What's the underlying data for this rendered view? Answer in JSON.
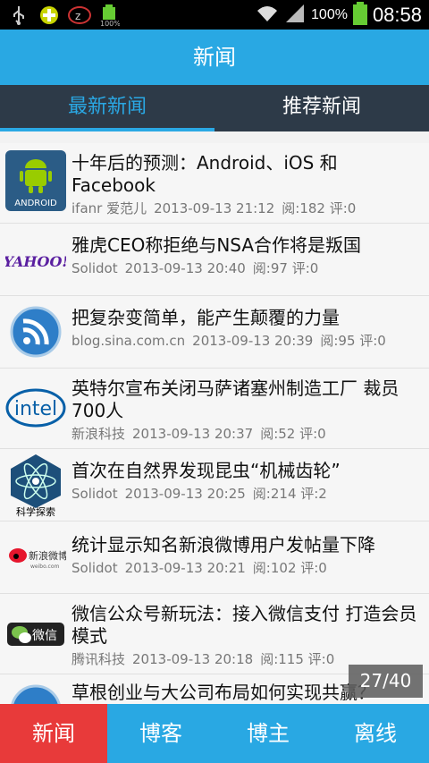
{
  "statusbar": {
    "battery_percent": "100%",
    "time": "08:58",
    "icons": [
      "usb-icon",
      "app-green-icon",
      "app-red-icon",
      "battery-small-icon"
    ],
    "battery_small_label": "100%"
  },
  "header": {
    "title": "新闻"
  },
  "tabs": [
    {
      "label": "最新新闻",
      "active": true
    },
    {
      "label": "推荐新闻",
      "active": false
    }
  ],
  "news": [
    {
      "logo": "android-logo",
      "title": "十年后的预测：Android、iOS 和 Facebook",
      "source": "ifanr 爱范儿",
      "time": "2013-09-13 21:12",
      "stats": "阅:182 评:0"
    },
    {
      "logo": "yahoo-logo",
      "title": "雅虎CEO称拒绝与NSA合作将是叛国",
      "source": "Solidot",
      "time": "2013-09-13 20:40",
      "stats": "阅:97 评:0"
    },
    {
      "logo": "sina-blog-logo",
      "title": "把复杂变简单，能产生颠覆的力量",
      "source": "blog.sina.com.cn",
      "time": "2013-09-13 20:39",
      "stats": "阅:95 评:0"
    },
    {
      "logo": "intel-logo",
      "title": "英特尔宣布关闭马萨诸塞州制造工厂 裁员700人",
      "source": "新浪科技",
      "time": "2013-09-13 20:37",
      "stats": "阅:52 评:0"
    },
    {
      "logo": "science-logo",
      "logo_text": "科学探索",
      "title": "首次在自然界发现昆虫“机械齿轮”",
      "source": "Solidot",
      "time": "2013-09-13 20:25",
      "stats": "阅:214 评:2"
    },
    {
      "logo": "weibo-logo",
      "logo_text": "新浪微博",
      "logo_subtext": "weibo.com",
      "title": "统计显示知名新浪微博用户发帖量下降",
      "source": "Solidot",
      "time": "2013-09-13 20:21",
      "stats": "阅:102 评:0"
    },
    {
      "logo": "wechat-logo",
      "logo_text": "微信",
      "title": "微信公众号新玩法：接入微信支付 打造会员模式",
      "source": "腾讯科技",
      "time": "2013-09-13 20:18",
      "stats": "阅:115 评:0"
    },
    {
      "logo": "sina-blog-logo",
      "title": "草根创业与大公司布局如何实现共赢？",
      "source": "",
      "time": "",
      "stats": ""
    }
  ],
  "pager": "27/40",
  "bottom_nav": [
    {
      "label": "新闻",
      "active": true
    },
    {
      "label": "博客",
      "active": false
    },
    {
      "label": "博主",
      "active": false
    },
    {
      "label": "离线",
      "active": false
    }
  ],
  "colors": {
    "header_blue": "#29a8e3",
    "tab_bg": "#2d3a48",
    "active_red": "#e83a3a"
  },
  "yahoo_text": "YAHOO!",
  "intel_text": "intel",
  "android_text": "ANDROID"
}
